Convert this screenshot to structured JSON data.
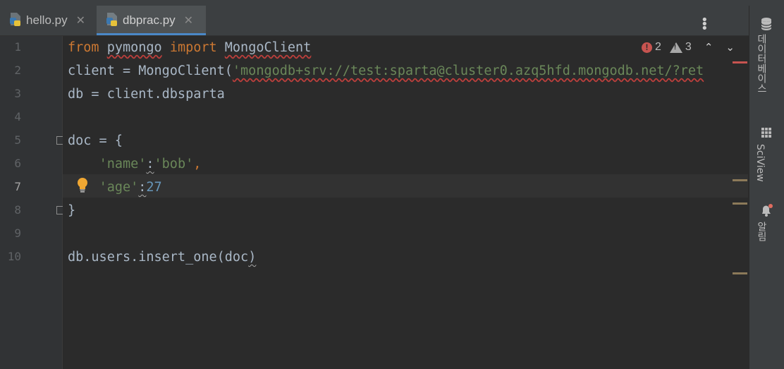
{
  "tabs": [
    {
      "label": "hello.py",
      "close": "✕",
      "active": false
    },
    {
      "label": "dbprac.py",
      "close": "✕",
      "active": true
    }
  ],
  "menu_icon": "⋮",
  "gutter": {
    "line_numbers": [
      "1",
      "2",
      "3",
      "4",
      "5",
      "6",
      "7",
      "8",
      "9",
      "10"
    ],
    "current_line": "7"
  },
  "editor": {
    "line1": {
      "kw_from": "from",
      "module": "pymongo",
      "kw_import": "import",
      "name": "MongoClient"
    },
    "line2": {
      "prefix": "client = MongoClient(",
      "string": "'mongodb+srv://test:sparta@cluster0.azq5hfd.mongodb.net/?ret"
    },
    "line3": {
      "text": "db = client.dbsparta"
    },
    "line5": {
      "text": "doc = {"
    },
    "line6": {
      "indent": "    ",
      "key": "'name'",
      "colon": ":",
      "value": "'bob'",
      "comma": ","
    },
    "line7": {
      "indent": "    ",
      "key": "'age'",
      "colon": ":",
      "value": "27"
    },
    "line8": {
      "text": "}"
    },
    "line10": {
      "prefix": "db.users.insert_one(doc",
      "suffix": ")"
    }
  },
  "inspections": {
    "errors": "2",
    "warnings": "3",
    "error_icon": "!",
    "warning_icon": "!",
    "prev_icon": "⌃",
    "next_icon": "⌄"
  },
  "right_panel": {
    "database_label": "데이터베이스",
    "sciview_label": "SciView",
    "notifications_label": "알림"
  },
  "colors": {
    "keyword": "#cc7832",
    "string": "#6a8759",
    "number": "#6897bb",
    "text": "#a9b7c6",
    "accent": "#4a88c7",
    "error": "#c75450"
  }
}
